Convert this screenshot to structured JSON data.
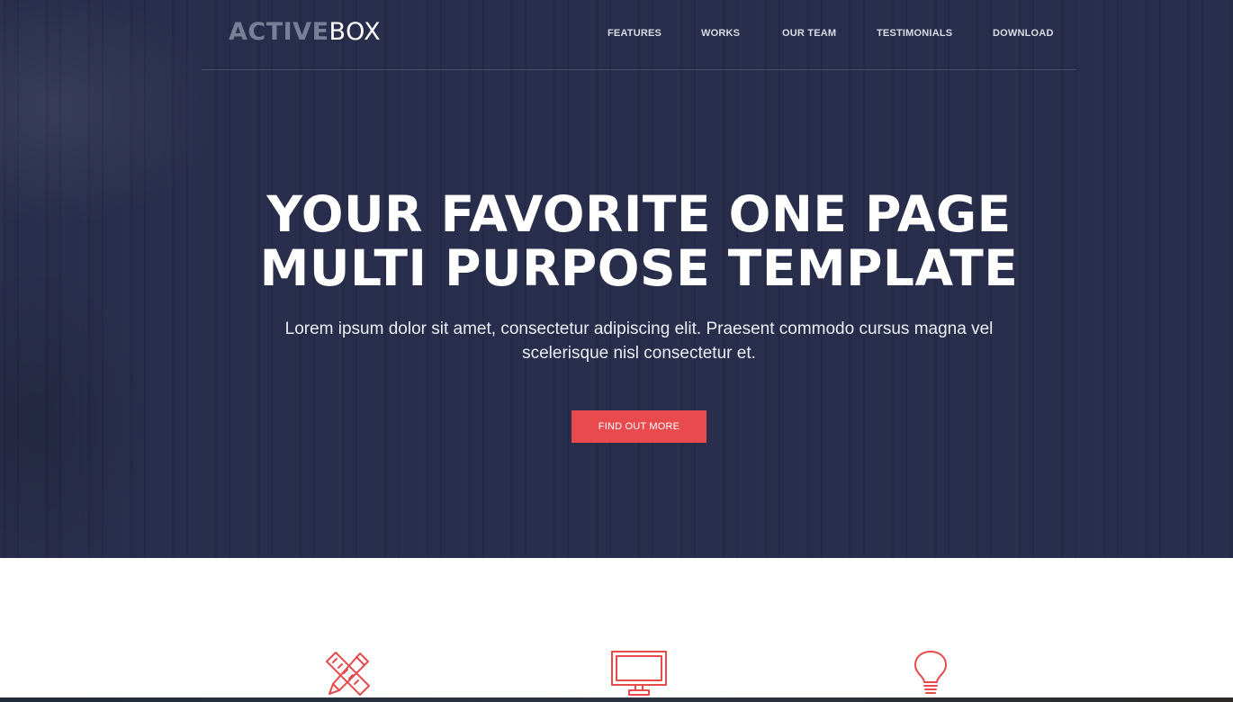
{
  "brand": {
    "logo_bold": "ACTIVE",
    "logo_light": "BOX"
  },
  "nav": {
    "items": [
      {
        "label": "FEATURES"
      },
      {
        "label": "WORKS"
      },
      {
        "label": "OUR TEAM"
      },
      {
        "label": "TESTIMONIALS"
      },
      {
        "label": "DOWNLOAD"
      }
    ]
  },
  "hero": {
    "title_line1": "YOUR FAVORITE ONE PAGE",
    "title_line2": "MULTI PURPOSE TEMPLATE",
    "subtitle": "Lorem ipsum dolor sit amet, consectetur adipiscing elit. Praesent commodo cursus magna vel scelerisque nisl consectetur et.",
    "cta_label": "FIND OUT MORE"
  },
  "features": {
    "icons": [
      "pencil-ruler-icon",
      "monitor-icon",
      "lightbulb-icon"
    ]
  },
  "colors": {
    "hero_background": "#262b49",
    "accent": "#e84a4e",
    "logo_muted": "#7a7f98",
    "text_light": "#ffffff"
  }
}
